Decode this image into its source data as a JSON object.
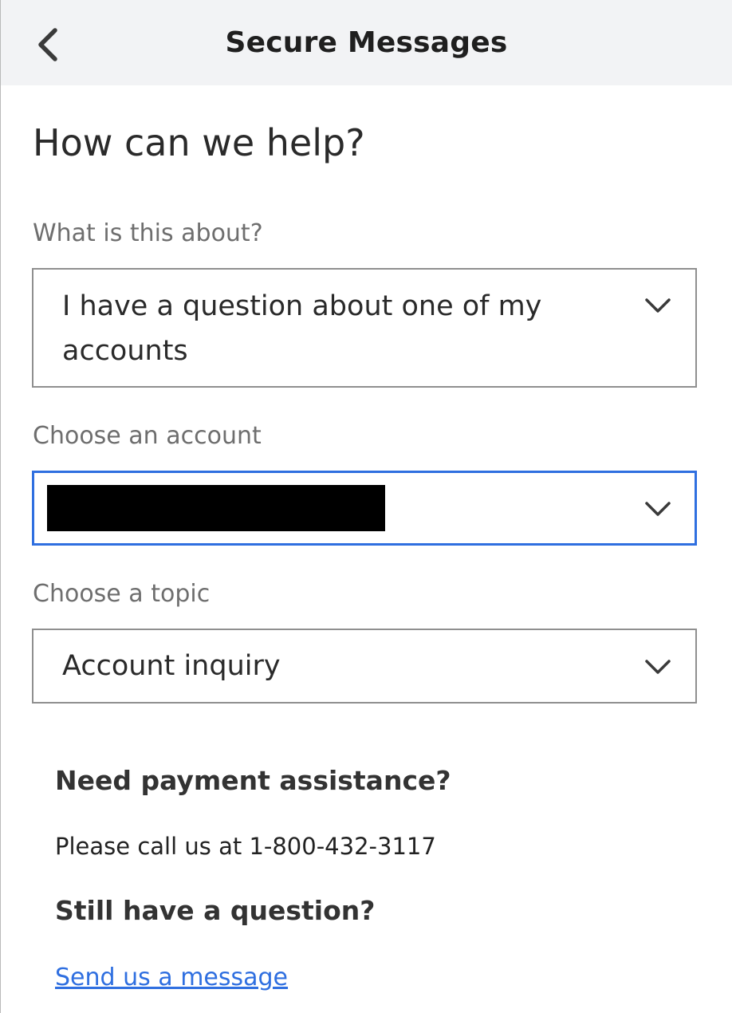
{
  "header": {
    "title": "Secure Messages",
    "back_icon": "chevron-left-icon"
  },
  "page_title": "How can we help?",
  "form": {
    "about": {
      "label": "What is this about?",
      "value_line1": "I have a question about one of my",
      "value_line2": "accounts"
    },
    "account": {
      "label": "Choose an account",
      "value": "",
      "redacted": true
    },
    "topic": {
      "label": "Choose a topic",
      "value": "Account inquiry"
    }
  },
  "payment": {
    "heading": "Need payment assistance?",
    "text": "Please call us at 1-800-432-3117"
  },
  "question": {
    "heading": "Still have a question?",
    "link": "Send us a message"
  },
  "colors": {
    "accent": "#2f6fe0",
    "header_bg": "#f2f3f5",
    "label": "#6e6e6e"
  }
}
